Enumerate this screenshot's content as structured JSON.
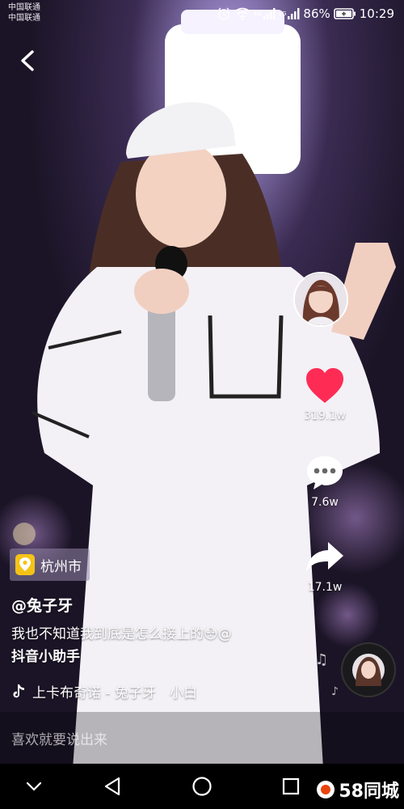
{
  "status": {
    "carrier_1": "中国联通",
    "carrier_2": "中国联通",
    "network_1": "4G",
    "network_2": "2G",
    "battery": "86%",
    "time": "10:29"
  },
  "video": {
    "location": "杭州市",
    "username": "@兔子牙",
    "caption_text": "我也不知道我到底是怎么接上的😳@",
    "caption_mention": "抖音小助手",
    "music": "上卡布奇诺 - 兔子牙　小白"
  },
  "actions": {
    "likes": "319.1w",
    "comments": "7.6w",
    "shares": "17.1w"
  },
  "comment_bar": {
    "placeholder": "喜欢就要说出来"
  },
  "watermark": {
    "text": "58同城"
  },
  "colors": {
    "like": "#fe2c55",
    "background": "#2a1f3a"
  }
}
